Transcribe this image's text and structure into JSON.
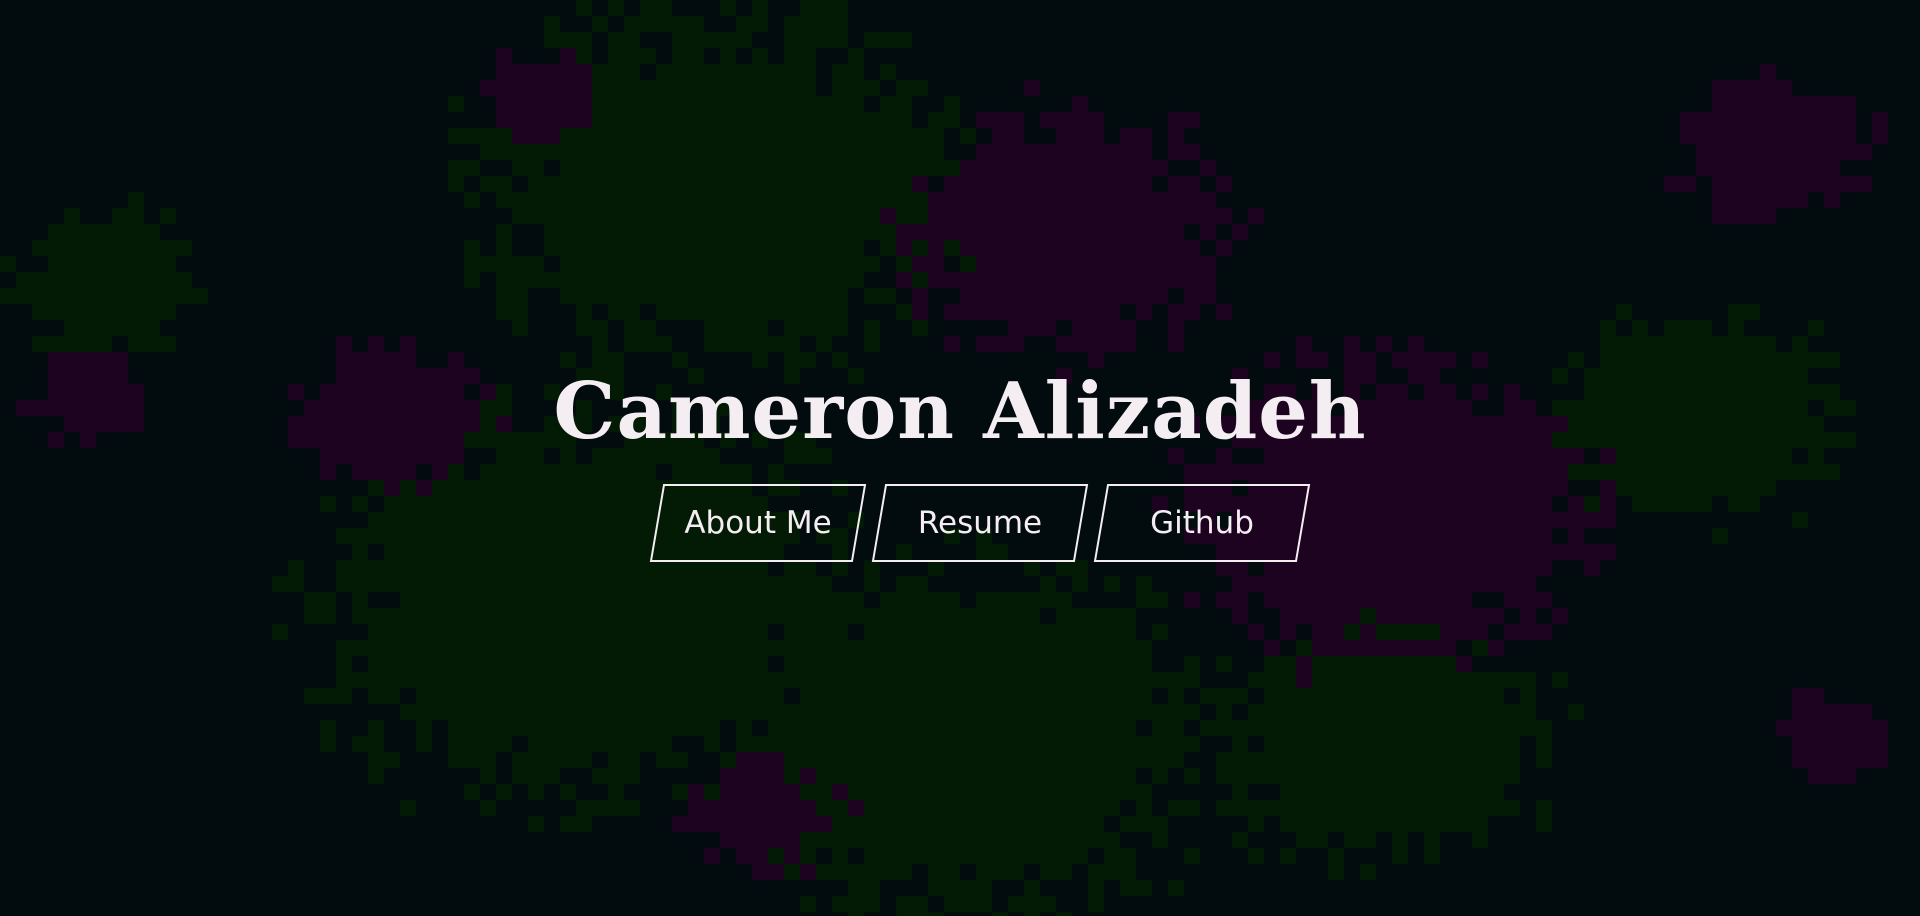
{
  "hero": {
    "name": "Cameron Alizadeh"
  },
  "nav": {
    "about_label": "About Me",
    "resume_label": "Resume",
    "github_label": "Github"
  },
  "colors": {
    "background": "#020b0d",
    "green_blob": "#031b04",
    "purple_blob": "#1e0321",
    "text": "#f4eef2",
    "button_border": "#f4eef2"
  }
}
